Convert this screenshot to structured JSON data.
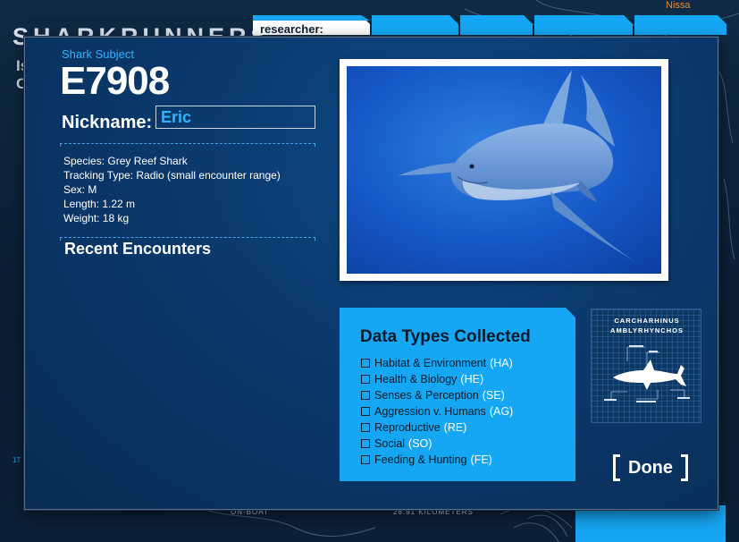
{
  "background": {
    "logo": "SHARKRUNNERS",
    "left_text_line1": "Is",
    "left_text_line2": "C",
    "tab_label": "researcher:",
    "orange_text": "Nissa",
    "bottom_label_1": "ON-BOAT",
    "bottom_label_2": "28.91 KILOMETERS",
    "side_glyph": "1T"
  },
  "subject": {
    "label": "Shark Subject",
    "id": "E7908",
    "nickname_label": "Nickname:",
    "nickname_value": "Eric"
  },
  "facts": {
    "species": "Species: Grey Reef Shark",
    "tracking": "Tracking Type: Radio (small encounter range)",
    "sex": "Sex: M",
    "length": "Length: 1.22 m",
    "weight": "Weight: 18 kg"
  },
  "encounters": {
    "title": "Recent Encounters"
  },
  "data_types": {
    "title": "Data Types Collected",
    "items": [
      {
        "label": "Habitat & Environment",
        "code": "(HA)"
      },
      {
        "label": "Health & Biology",
        "code": "(HE)"
      },
      {
        "label": "Senses & Perception",
        "code": "(SE)"
      },
      {
        "label": "Aggression v. Humans",
        "code": "(AG)"
      },
      {
        "label": "Reproductive",
        "code": "(RE)"
      },
      {
        "label": "Social",
        "code": "(SO)"
      },
      {
        "label": "Feeding & Hunting",
        "code": "(FE)"
      }
    ]
  },
  "species_card": {
    "line1": "CARCHARHINUS",
    "line2": "AMBLYRHYNCHOS"
  },
  "done_label": "Done",
  "colors": {
    "accent": "#16a7f4",
    "nickname_text": "#30b4ff",
    "modal_bg": "#0b3a6e"
  }
}
